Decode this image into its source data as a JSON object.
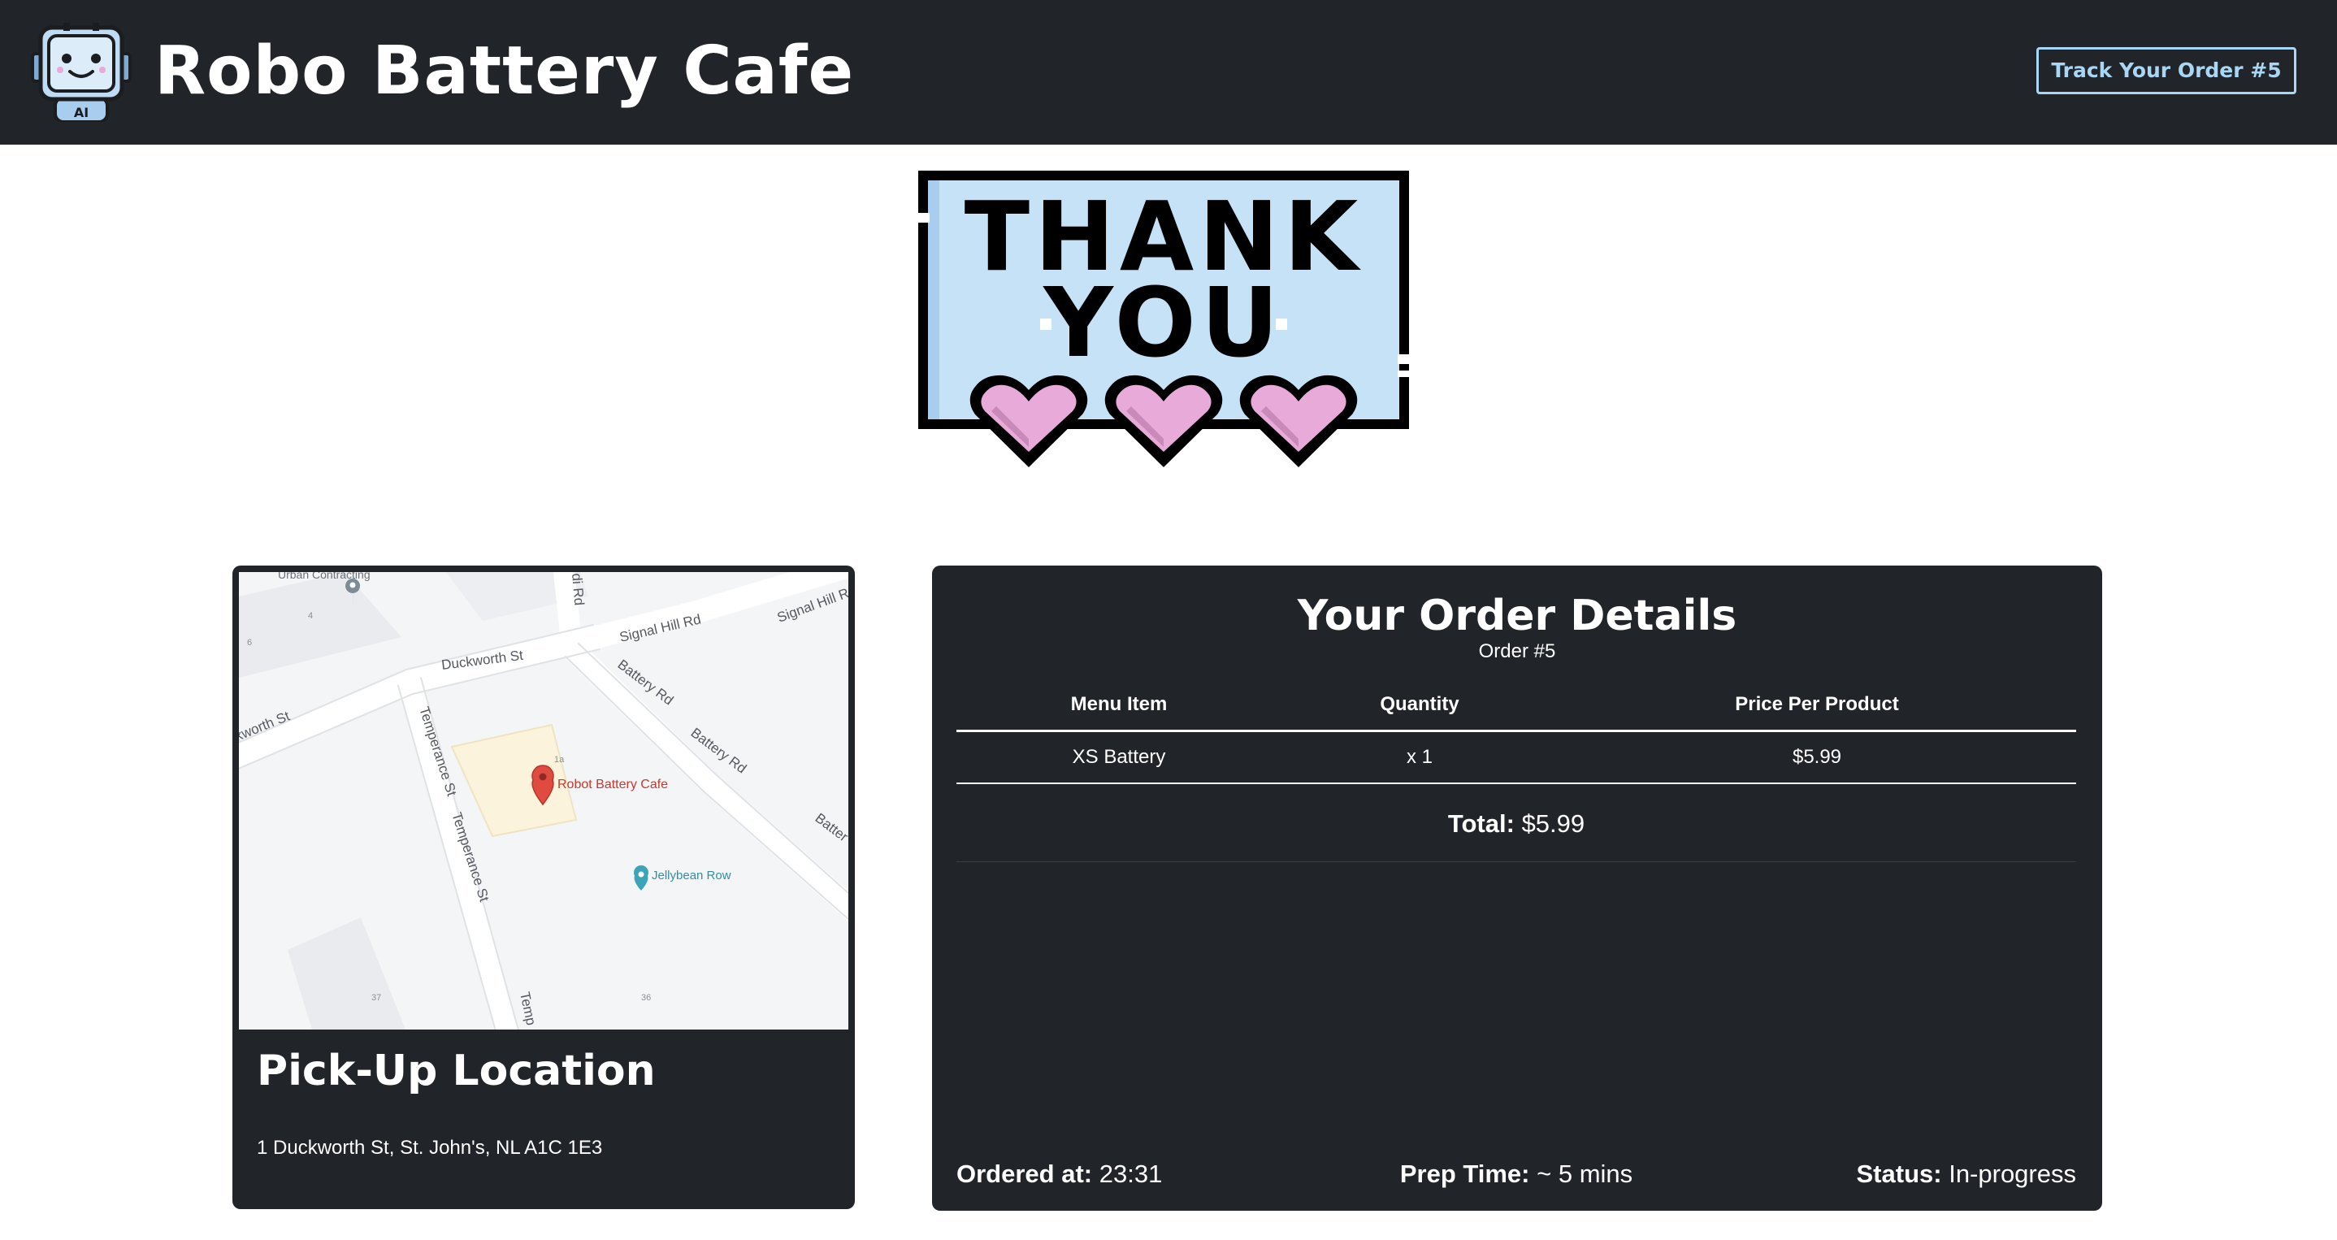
{
  "header": {
    "brand": "Robo Battery Cafe",
    "logo_text": "AI",
    "track_button": "Track Your Order #5"
  },
  "hero": {
    "line1": "THANK",
    "line2": "YOU",
    "icon": "thank-you-hearts-sign",
    "colors": {
      "sign": "#c6e2f7",
      "heart": "#e8aad8"
    }
  },
  "map": {
    "streets": [
      "Duckworth St",
      "Signal Hill Rd",
      "Signal Hill Rd",
      "Battery Rd",
      "Battery Rd",
      "Batter",
      "kworth St",
      "Temperance St",
      "Temperance St",
      "Temp",
      "di Rd"
    ],
    "places": [
      "Robot Battery Cafe",
      "Jellybean Row",
      "Urban Contracting"
    ],
    "numbers": [
      "4",
      "6",
      "1a",
      "37",
      "36"
    ]
  },
  "pickup": {
    "title": "Pick-Up Location",
    "address": "1 Duckworth St, St. John's, NL A1C 1E3"
  },
  "order": {
    "title": "Your Order Details",
    "subtitle": "Order #5",
    "columns": [
      "Menu Item",
      "Quantity",
      "Price Per Product"
    ],
    "rows": [
      {
        "item": "XS Battery",
        "qty": "x 1",
        "price": "$5.99"
      }
    ],
    "total_label": "Total:",
    "total_value": "$5.99",
    "ordered_label": "Ordered at:",
    "ordered_value": "23:31",
    "prep_label": "Prep Time:",
    "prep_value": "~ 5 mins",
    "status_label": "Status:",
    "status_value": "In-progress"
  },
  "colors": {
    "header_bg": "#212428",
    "card_bg": "#212428",
    "accent": "#a9d6f5",
    "map_pin": "#e04b40"
  }
}
